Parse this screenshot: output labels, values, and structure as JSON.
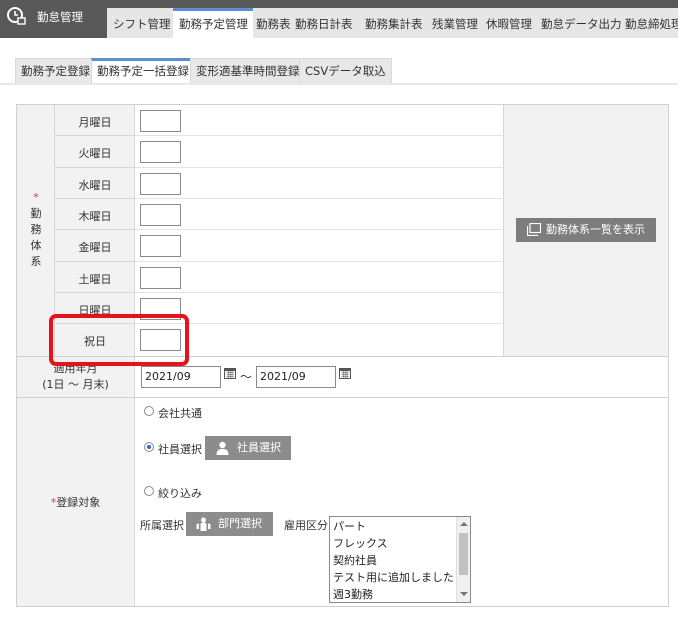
{
  "app": {
    "title": "勤怠管理"
  },
  "menu": {
    "items": [
      {
        "label": "シフト管理"
      },
      {
        "label": "勤務予定管理"
      },
      {
        "label": "勤務表"
      },
      {
        "label": "勤務日計表"
      },
      {
        "label": "勤務集計表"
      },
      {
        "label": "残業管理"
      },
      {
        "label": "休暇管理"
      },
      {
        "label": "勤怠データ出力"
      },
      {
        "label": "勤怠締処理"
      }
    ],
    "active_index": 1
  },
  "subtabs": {
    "items": [
      {
        "label": "勤務予定登録"
      },
      {
        "label": "勤務予定一括登録"
      },
      {
        "label": "変形適基準時間登録"
      },
      {
        "label": "CSVデータ取込"
      }
    ],
    "active_index": 1
  },
  "form": {
    "kinmu": {
      "required_mark": "*",
      "label_chars": [
        "勤",
        "務",
        "体",
        "系"
      ],
      "days": [
        {
          "label": "月曜日",
          "value": ""
        },
        {
          "label": "火曜日",
          "value": ""
        },
        {
          "label": "水曜日",
          "value": ""
        },
        {
          "label": "木曜日",
          "value": ""
        },
        {
          "label": "金曜日",
          "value": ""
        },
        {
          "label": "土曜日",
          "value": ""
        },
        {
          "label": "日曜日",
          "value": ""
        },
        {
          "label": "祝日",
          "value": ""
        }
      ],
      "list_button": "勤務体系一覧を表示"
    },
    "period": {
      "label_line1": "適用年月",
      "label_line2": "(1日 ～ 月末)",
      "from": "2021/09",
      "separator": "～",
      "to": "2021/09"
    },
    "target": {
      "required_mark": "*",
      "label": "登録対象",
      "options": [
        {
          "label": "会社共通",
          "selected": false
        },
        {
          "label": "社員選択",
          "selected": true
        },
        {
          "label": "絞り込み",
          "selected": false
        }
      ],
      "employee_button": "社員選択",
      "dept_label": "所属選択",
      "dept_button": "部門選択",
      "employment_label": "雇用区分",
      "employment_options": [
        "パート",
        "フレックス",
        "契約社員",
        "テスト用に追加しました",
        "週3勤務"
      ]
    }
  },
  "colors": {
    "topbar": "#595959",
    "accent": "#5b8fd1",
    "highlight": "#e8121c",
    "required": "#e8303b"
  }
}
